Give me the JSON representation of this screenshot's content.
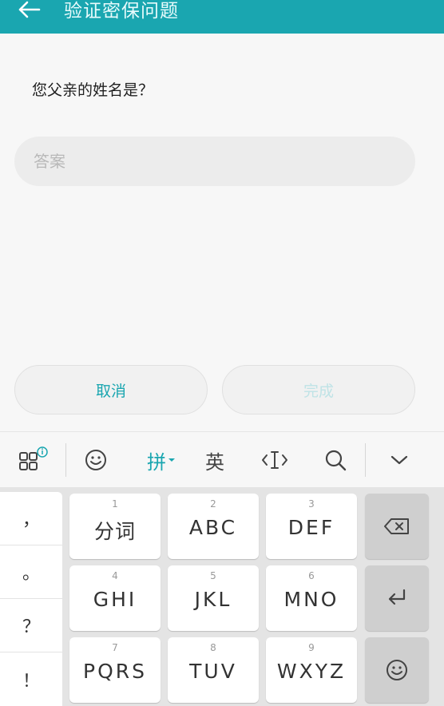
{
  "header": {
    "title": "验证密保问题",
    "back_icon": "arrow-left-icon"
  },
  "question": "您父亲的姓名是？",
  "answer": {
    "placeholder": "答案",
    "value": ""
  },
  "buttons": {
    "cancel": "取消",
    "done": "完成"
  },
  "ime_toolbar": {
    "items": [
      {
        "icon": "grid-menu-icon"
      },
      {
        "icon": "emoji-icon"
      },
      {
        "label": "拼",
        "icon": "dropdown-caret-icon",
        "active": true
      },
      {
        "label": "英"
      },
      {
        "icon": "cursor-move-icon"
      },
      {
        "icon": "search-icon"
      },
      {
        "icon": "chevron-down-icon"
      }
    ]
  },
  "keyboard": {
    "symbols": [
      "，",
      "。",
      "？",
      "！"
    ],
    "keys": [
      {
        "num": "1",
        "label": "分词"
      },
      {
        "num": "2",
        "label": "ABC"
      },
      {
        "num": "3",
        "label": "DEF"
      },
      {
        "num": "4",
        "label": "GHI"
      },
      {
        "num": "5",
        "label": "JKL"
      },
      {
        "num": "6",
        "label": "MNO"
      },
      {
        "num": "7",
        "label": "PQRS"
      },
      {
        "num": "8",
        "label": "TUV"
      },
      {
        "num": "9",
        "label": "WXYZ"
      }
    ],
    "function_keys": [
      "backspace-icon",
      "enter-icon",
      "emoji-icon"
    ]
  },
  "colors": {
    "accent": "#1aa6b0",
    "done_disabled": "#bfe3e6"
  }
}
